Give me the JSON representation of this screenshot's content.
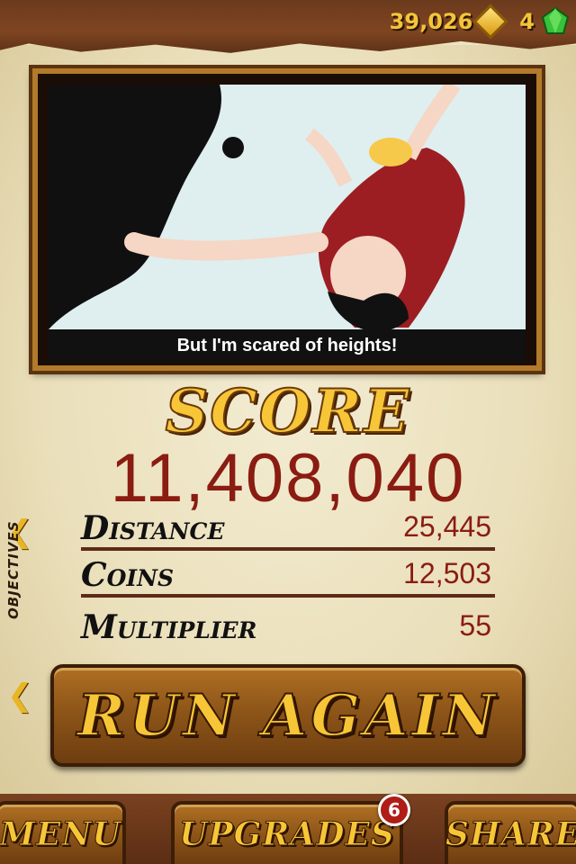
{
  "currency": {
    "coins": "39,026",
    "gems": "4",
    "coin_icon": "coin-diamond-icon",
    "gem_icon": "green-gem-icon"
  },
  "cutscene": {
    "caption": "But I'm scared of heights!"
  },
  "score": {
    "title": "SCORE",
    "value": "11,408,040"
  },
  "stats": [
    {
      "label": "Distance",
      "value": "25,445"
    },
    {
      "label": "Coins",
      "value": "12,503"
    },
    {
      "label": "Multiplier",
      "value": "55"
    }
  ],
  "objectives": {
    "label": "OBJECTIVES"
  },
  "buttons": {
    "run_again": "RUN AGAIN",
    "menu": "MENU",
    "upgrades": "UPGRADES",
    "upgrades_badge": "6",
    "share": "SHARE"
  },
  "colors": {
    "gold_text": "#f7c637",
    "score_red": "#8a1c12",
    "leather": "#6b3a1c",
    "parchment": "#eadfba"
  }
}
